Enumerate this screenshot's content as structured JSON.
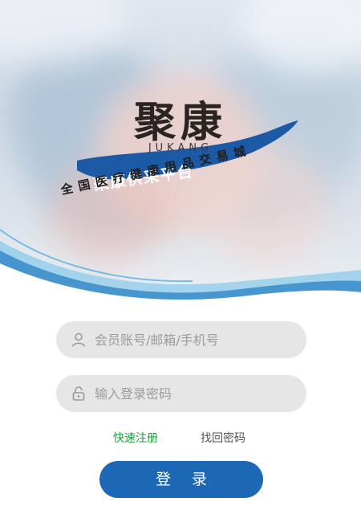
{
  "brand": {
    "title": "聚康",
    "subtitle": "JUKANG",
    "platform_name": "聚康供采平台",
    "tagline": "全国医疗健康用品交易城"
  },
  "login": {
    "account_placeholder": "会员账号/邮箱/手机号",
    "password_placeholder": "输入登录密码",
    "register_link": "快速注册",
    "forgot_link": "找回密码",
    "submit_label": "登 录"
  },
  "colors": {
    "primary": "#1d68b4",
    "register_link": "#1aa33a",
    "forgot_link": "#555555",
    "field_bg": "#e6e6e6"
  },
  "icons": {
    "account": "user-icon",
    "password": "lock-icon"
  }
}
